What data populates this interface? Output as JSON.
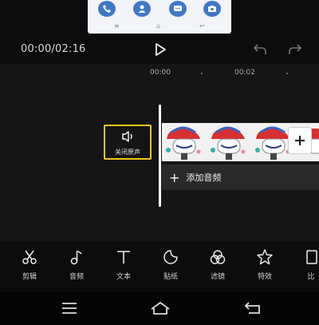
{
  "player": {
    "time_readout": "00:00/02:16"
  },
  "ruler": {
    "marks": [
      "00:00",
      "00:02"
    ]
  },
  "timeline": {
    "mute_label": "关闭原声",
    "add_audio_label": "添加音频",
    "add_audio_icon": "+"
  },
  "tools": [
    {
      "label": "剪辑",
      "icon": "scissors-icon"
    },
    {
      "label": "音频",
      "icon": "music-note-icon"
    },
    {
      "label": "文本",
      "icon": "text-icon"
    },
    {
      "label": "贴纸",
      "icon": "sticker-icon"
    },
    {
      "label": "滤镜",
      "icon": "filter-icon"
    },
    {
      "label": "特效",
      "icon": "effects-icon"
    },
    {
      "label": "比",
      "icon": "ratio-icon"
    }
  ],
  "colors": {
    "accent": "#f0c419",
    "background": "#0c0c0c",
    "timeline_bg": "#151515"
  }
}
